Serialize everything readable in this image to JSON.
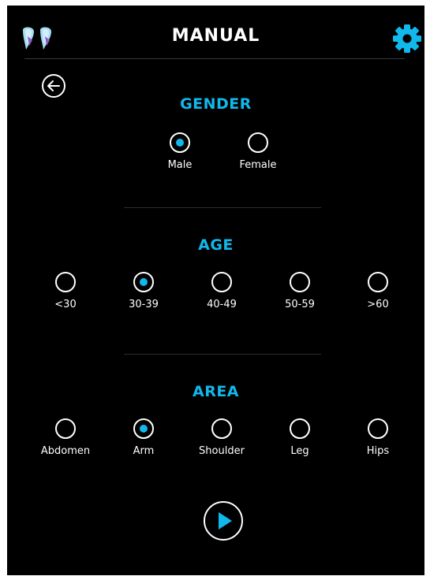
{
  "header": {
    "title": "MANUAL",
    "logo_icon": "twin-drops-logo-icon",
    "settings_icon": "gear-icon"
  },
  "back_icon": "arrow-left-circle-icon",
  "gender": {
    "title": "GENDER",
    "options": [
      "Male",
      "Female"
    ],
    "selected": "Male"
  },
  "age": {
    "title": "AGE",
    "options": [
      "<30",
      "30-39",
      "40-49",
      "50-59",
      ">60"
    ],
    "selected": "30-39"
  },
  "area": {
    "title": "AREA",
    "options": [
      "Abdomen",
      "Arm",
      "Shoulder",
      "Leg",
      "Hips"
    ],
    "selected": "Arm"
  },
  "play_icon": "play-icon",
  "colors": {
    "accent": "#11b8ec",
    "background": "#000000",
    "text": "#ffffff"
  }
}
